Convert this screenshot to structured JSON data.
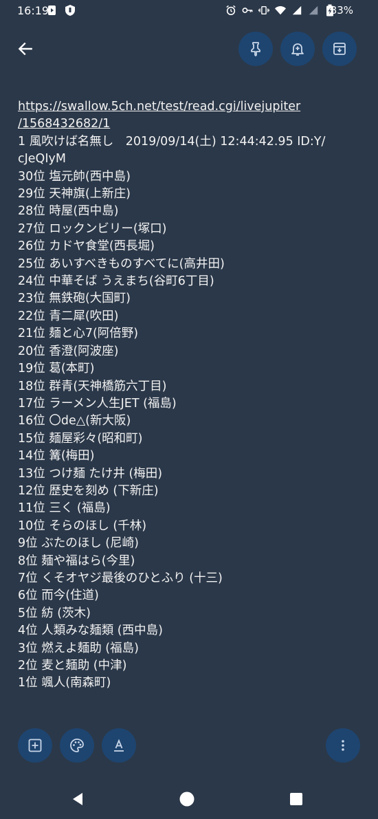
{
  "status_bar": {
    "time": "16:19",
    "battery_percent": "83%"
  },
  "toolbar": {
    "back": "back",
    "pin": "pin",
    "reminder": "reminder",
    "archive": "archive"
  },
  "note": {
    "url_lines": [
      "https://swallow.5ch.net/test/read.cgi/livejupiter",
      "/1568432682/1"
    ],
    "header_lines": [
      "1 風吹けば名無し　2019/09/14(土) 12:44:42.95 ID:Y/",
      "cJeQIyM"
    ],
    "ranking": [
      "30位 塩元帥(西中島)",
      "29位 天神旗(上新庄)",
      "28位 時屋(西中島)",
      "27位 ロックンビリー(塚口)",
      "26位 カドヤ食堂(西長堀)",
      "25位 あいすべきものすべてに(高井田)",
      "24位 中華そば うえまち(谷町6丁目)",
      "23位 無鉄砲(大国町)",
      "22位 青二犀(吹田)",
      "21位 麺と心7(阿倍野)",
      "20位 香澄(阿波座)",
      "19位 葛(本町)",
      "18位 群青(天神橋筋六丁目)",
      "17位 ラーメン人生JET (福島)",
      "16位 〇de△(新大阪)",
      "15位 麺屋彩々(昭和町)",
      "14位 篝(梅田)",
      "13位 つけ麺 たけ井 (梅田)",
      "12位 歴史を刻め (下新庄)",
      "11位 三く (福島)",
      "10位 そらのほし (千林)",
      "9位 ぶたのほし (尼崎)",
      "8位 麺や福はら(今里)",
      "7位 くそオヤジ最後のひとふり (十三)",
      "6位 而今(住道)",
      "5位 紡 (茨木)",
      "4位 人類みな麺類 (西中島)",
      "3位 燃えよ麺助 (福島)",
      "2位 麦と麺助 (中津)",
      "1位 颯人(南森町)"
    ]
  },
  "bottom_actions": {
    "add": "add-box",
    "palette": "palette",
    "text_format": "text-format",
    "more": "more-vert"
  },
  "colors": {
    "background": "#2b3849",
    "button_bg": "#1e4570",
    "icon": "#c9d6e8"
  }
}
